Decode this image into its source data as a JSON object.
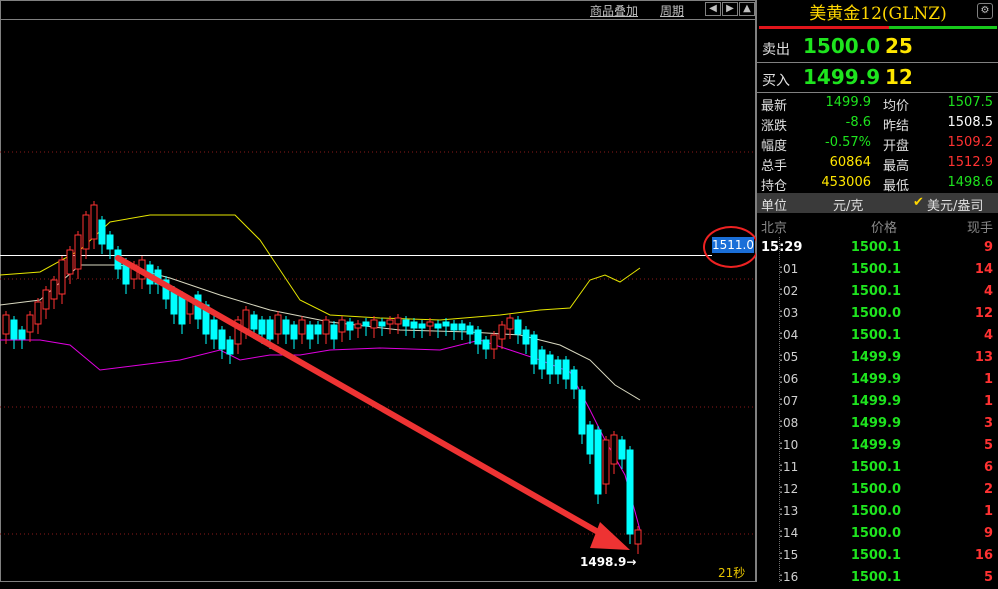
{
  "toolbar": {
    "overlay_label": "商品叠加",
    "period_label": "周期",
    "nav_icons": [
      "arrow-left-icon",
      "arrow-right-icon",
      "arrow-up-icon"
    ]
  },
  "chart": {
    "current_price_label": "1511.0",
    "low_label": "1498.9",
    "timer_label": "21秒",
    "colors": {
      "up": "#ff3232",
      "down": "#00ffff",
      "upper_band": "#e6e600",
      "mid_band": "#d8d8c0",
      "lower_band": "#e000e0",
      "arrow": "#ee3333",
      "price_line": "#ffffff"
    }
  },
  "panel": {
    "title": "美黄金12(GLNZ)",
    "settings_icon": "gear-icon",
    "sell": {
      "label": "卖出",
      "price": "1500.0",
      "qty": "25"
    },
    "buy": {
      "label": "买入",
      "price": "1499.9",
      "qty": "12"
    },
    "quotes": [
      {
        "l1": "最新",
        "v1": "1499.9",
        "c1": "#1ee41e",
        "l2": "均价",
        "v2": "1507.5",
        "c2": "#1ee41e"
      },
      {
        "l1": "涨跌",
        "v1": "-8.6",
        "c1": "#1ee41e",
        "l2": "昨结",
        "v2": "1508.5",
        "c2": "#ffffff"
      },
      {
        "l1": "幅度",
        "v1": "-0.57%",
        "c1": "#1ee41e",
        "l2": "开盘",
        "v2": "1509.2",
        "c2": "#ff3232"
      },
      {
        "l1": "总手",
        "v1": "60864",
        "c1": "#ffe600",
        "l2": "最高",
        "v2": "1512.9",
        "c2": "#ff3232"
      },
      {
        "l1": "持仓",
        "v1": "453006",
        "c1": "#ffe600",
        "l2": "最低",
        "v2": "1498.6",
        "c2": "#1ee41e"
      }
    ],
    "unit": {
      "label": "单位",
      "cny": "元/克",
      "check_icon": "checkmark-icon",
      "usd": "美元/盎司"
    },
    "ticks_header": {
      "time": "北京",
      "price": "价格",
      "volume": "现手"
    },
    "ticks": [
      {
        "time": "15:29",
        "price": "1500.1",
        "vol": "9"
      },
      {
        "time": ":01",
        "price": "1500.1",
        "vol": "14"
      },
      {
        "time": ":02",
        "price": "1500.1",
        "vol": "4"
      },
      {
        "time": ":03",
        "price": "1500.0",
        "vol": "12"
      },
      {
        "time": ":04",
        "price": "1500.1",
        "vol": "4"
      },
      {
        "time": ":05",
        "price": "1499.9",
        "vol": "13"
      },
      {
        "time": ":06",
        "price": "1499.9",
        "vol": "1"
      },
      {
        "time": ":07",
        "price": "1499.9",
        "vol": "1"
      },
      {
        "time": ":08",
        "price": "1499.9",
        "vol": "3"
      },
      {
        "time": ":10",
        "price": "1499.9",
        "vol": "5"
      },
      {
        "time": ":11",
        "price": "1500.1",
        "vol": "6"
      },
      {
        "time": ":12",
        "price": "1500.0",
        "vol": "2"
      },
      {
        "time": ":13",
        "price": "1500.0",
        "vol": "1"
      },
      {
        "time": ":14",
        "price": "1500.0",
        "vol": "9"
      },
      {
        "time": ":15",
        "price": "1500.1",
        "vol": "16"
      },
      {
        "time": ":16",
        "price": "1500.1",
        "vol": "5"
      }
    ]
  }
}
